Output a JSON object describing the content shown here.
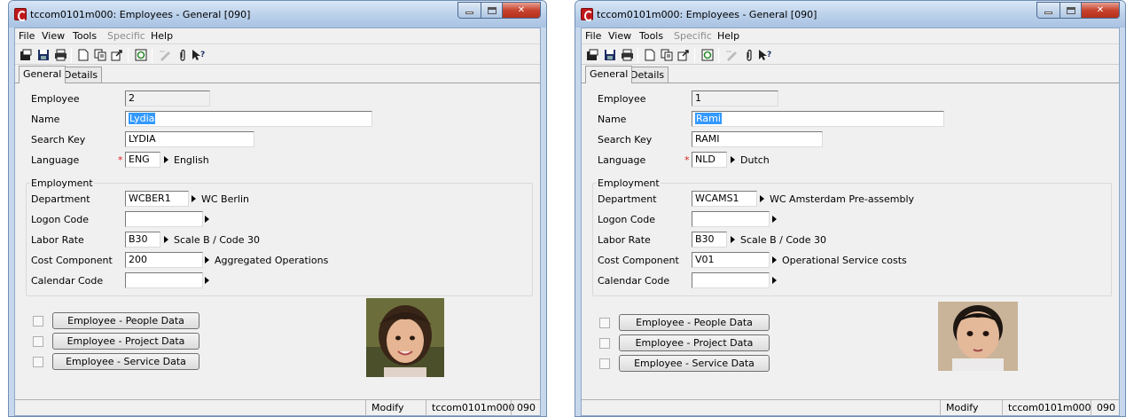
{
  "colors": {
    "titlebar": "#bcd2eb",
    "accent_selection": "#3399ff",
    "required": "#e02020",
    "window_bg": "#f0f0f0"
  },
  "windows": [
    {
      "title": "tccom0101m000: Employees - General [090]",
      "menu": [
        {
          "label": "File",
          "disabled": false
        },
        {
          "label": "View",
          "disabled": false
        },
        {
          "label": "Tools",
          "disabled": false
        },
        {
          "label": "Specific",
          "disabled": true
        },
        {
          "label": "Help",
          "disabled": false
        }
      ],
      "tabs": [
        "General",
        "Details"
      ],
      "form": {
        "employee_label": "Employee",
        "employee_value": "2",
        "name_label": "Name",
        "name_value": "Lydia",
        "search_key_label": "Search Key",
        "search_key_value": "LYDIA",
        "language_label": "Language",
        "language_value": "ENG",
        "language_desc": "English",
        "employment_title": "Employment",
        "department_label": "Department",
        "department_value": "WCBER1",
        "department_desc": "WC Berlin",
        "logon_label": "Logon Code",
        "logon_value": "",
        "labor_rate_label": "Labor Rate",
        "labor_rate_value": "B30",
        "labor_rate_desc": "Scale B / Code 30",
        "cost_component_label": "Cost Component",
        "cost_component_value": "200",
        "cost_component_desc": "Aggregated Operations",
        "calendar_label": "Calendar Code",
        "calendar_value": ""
      },
      "buttons": [
        "Employee - People Data",
        "Employee - Project Data",
        "Employee - Service Data"
      ],
      "status": {
        "mode": "Modify",
        "session": "tccom0101m000",
        "company": "090"
      }
    },
    {
      "title": "tccom0101m000: Employees - General [090]",
      "menu": [
        {
          "label": "File",
          "disabled": false
        },
        {
          "label": "View",
          "disabled": false
        },
        {
          "label": "Tools",
          "disabled": false
        },
        {
          "label": "Specific",
          "disabled": true
        },
        {
          "label": "Help",
          "disabled": false
        }
      ],
      "tabs": [
        "General",
        "Details"
      ],
      "form": {
        "employee_label": "Employee",
        "employee_value": "1",
        "name_label": "Name",
        "name_value": "Rami",
        "search_key_label": "Search Key",
        "search_key_value": "RAMI",
        "language_label": "Language",
        "language_value": "NLD",
        "language_desc": "Dutch",
        "employment_title": "Employment",
        "department_label": "Department",
        "department_value": "WCAMS1",
        "department_desc": "WC Amsterdam Pre-assembly",
        "logon_label": "Logon Code",
        "logon_value": "",
        "labor_rate_label": "Labor Rate",
        "labor_rate_value": "B30",
        "labor_rate_desc": "Scale B / Code 30",
        "cost_component_label": "Cost Component",
        "cost_component_value": "V01",
        "cost_component_desc": "Operational Service costs",
        "calendar_label": "Calendar Code",
        "calendar_value": ""
      },
      "buttons": [
        "Employee - People Data",
        "Employee - Project Data",
        "Employee - Service Data"
      ],
      "status": {
        "mode": "Modify",
        "session": "tccom0101m000",
        "company": "090"
      }
    }
  ],
  "toolbar_icons": [
    "new-record-icon",
    "save-icon",
    "print-icon",
    "new-document-icon",
    "copy-icon",
    "export-icon",
    "refresh-icon",
    "text-icon",
    "attachment-icon",
    "help-pointer-icon"
  ]
}
